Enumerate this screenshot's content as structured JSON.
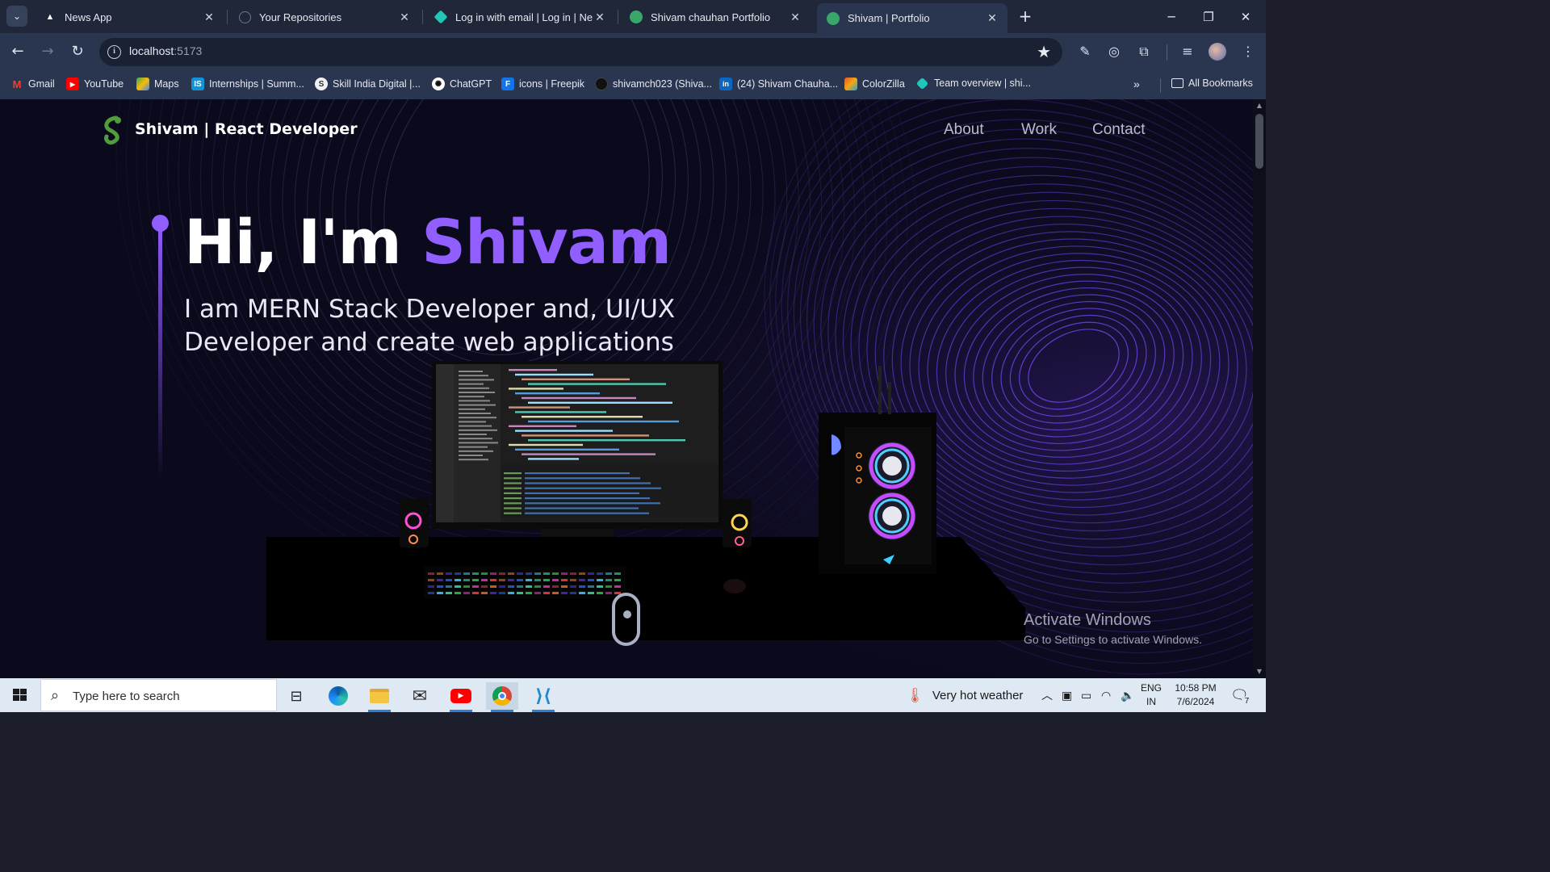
{
  "browser": {
    "tabs": [
      {
        "title": "News App",
        "icon": "news-app-icon",
        "active": false
      },
      {
        "title": "Your Repositories",
        "icon": "github-icon",
        "active": false
      },
      {
        "title": "Log in with email | Log in | Netli",
        "icon": "netlify-icon",
        "active": false
      },
      {
        "title": "Shivam chauhan Portfolio",
        "icon": "portfolio-icon",
        "active": false
      },
      {
        "title": "Shivam | Portfolio",
        "icon": "portfolio-icon",
        "active": true
      }
    ],
    "new_tab_label": "+",
    "url_host": "localhost",
    "url_port": ":5173",
    "bookmarks": [
      {
        "label": "Gmail",
        "icon": "gmail-icon",
        "color": "#ea4335"
      },
      {
        "label": "YouTube",
        "icon": "youtube-icon",
        "color": "#ff0000"
      },
      {
        "label": "Maps",
        "icon": "maps-icon",
        "color": "#34a853"
      },
      {
        "label": "Internships | Summ...",
        "icon": "internshala-icon",
        "color": "#1295d8"
      },
      {
        "label": "Skill India Digital |...",
        "icon": "skill-india-icon",
        "color": "#ffffff"
      },
      {
        "label": "ChatGPT",
        "icon": "chatgpt-icon",
        "color": "#ffffff"
      },
      {
        "label": "icons | Freepik",
        "icon": "freepik-icon",
        "color": "#1273eb"
      },
      {
        "label": "shivamch023 (Shiva...",
        "icon": "github-icon",
        "color": "#111111"
      },
      {
        "label": "(24) Shivam Chauha...",
        "icon": "linkedin-icon",
        "color": "#0a66c2"
      },
      {
        "label": "ColorZilla",
        "icon": "colorzilla-icon",
        "color": "#e4572e"
      },
      {
        "label": "Team overview | shi...",
        "icon": "netlify-icon",
        "color": "#20c6b6"
      }
    ],
    "all_bookmarks_label": "All Bookmarks"
  },
  "site": {
    "brand_name": "Shivam",
    "brand_suffix": "| React Developer",
    "nav": [
      "About",
      "Work",
      "Contact"
    ],
    "hero_greeting": "Hi, I'm",
    "hero_name": "Shivam",
    "hero_subtitle": "I am MERN Stack Developer and, UI/UX Developer and create web applications",
    "accent_color": "#915eff"
  },
  "watermark": {
    "title": "Activate Windows",
    "subtitle": "Go to Settings to activate Windows."
  },
  "taskbar": {
    "search_placeholder": "Type here to search",
    "weather_text": "Very hot weather",
    "lang_top": "ENG",
    "lang_bottom": "IN",
    "time": "10:58 PM",
    "date": "7/6/2024",
    "notification_count": "7"
  }
}
